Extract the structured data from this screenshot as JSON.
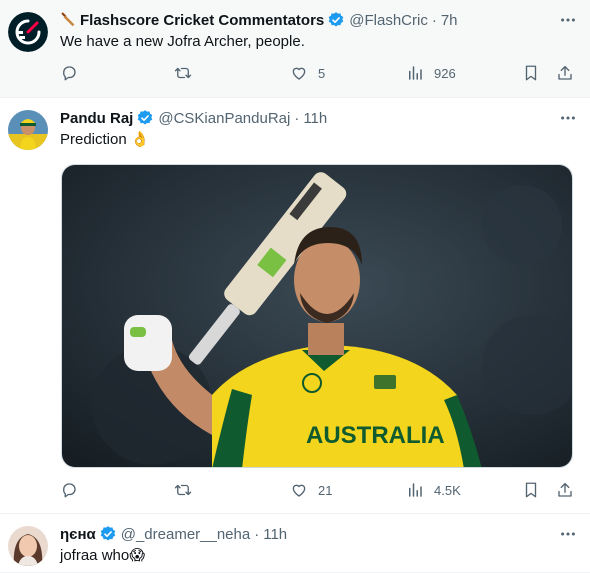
{
  "tweets": [
    {
      "name": "Flashscore Cricket Commentators",
      "handle": "@FlashCric",
      "separator": "·",
      "time": "7h",
      "text": "We have a new Jofra Archer, people.",
      "reply_count": "",
      "retweet_count": "",
      "like_count": "5",
      "view_count": "926"
    },
    {
      "name": "Pandu Raj",
      "handle": "@CSKianPanduRaj",
      "separator": "·",
      "time": "11h",
      "text": "Prediction 👌",
      "jersey_text": "AUSTRALIA",
      "reply_count": "",
      "retweet_count": "",
      "like_count": "21",
      "view_count": "4.5K"
    },
    {
      "name": "ηєнα",
      "handle": "@_dreamer__neha",
      "separator": "·",
      "time": "11h",
      "text": "jofraa who😱"
    }
  ],
  "colors": {
    "verified": "#1d9bf0",
    "secondary_text": "#536471",
    "highlight_bg": "#f7f9f9",
    "jersey_yellow": "#f2d51c",
    "jersey_green": "#0f5a2e"
  },
  "icons": [
    "bat-icon",
    "more-icon",
    "verified-icon",
    "reply-icon",
    "retweet-icon",
    "like-icon",
    "views-icon",
    "bookmark-icon",
    "share-icon"
  ]
}
